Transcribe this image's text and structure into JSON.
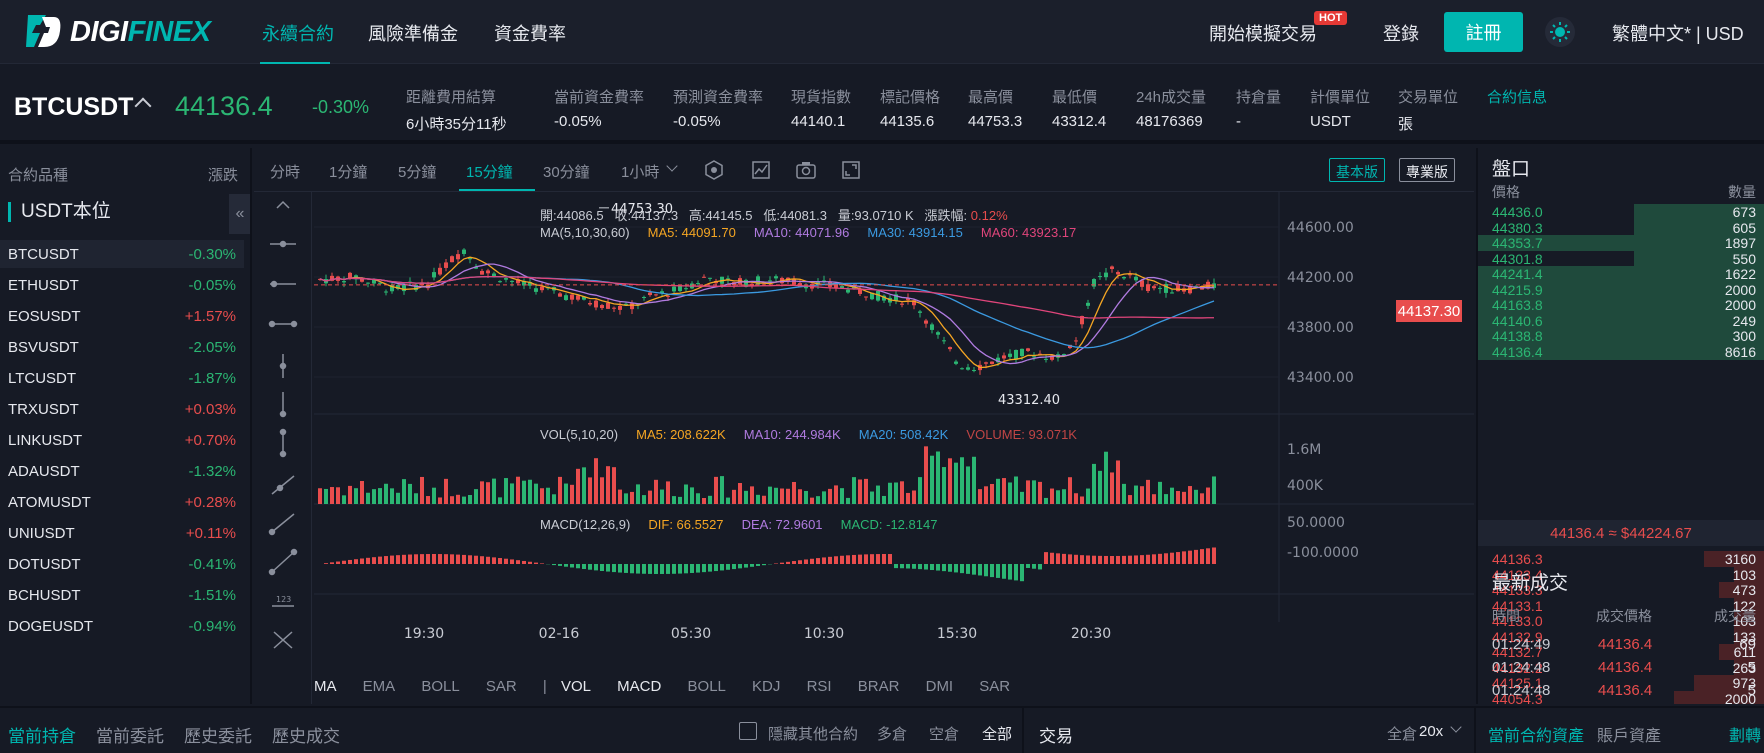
{
  "brand": {
    "logo_text_main": "DIGI",
    "logo_text_accent": "FINEX"
  },
  "nav": {
    "links": [
      "永續合約",
      "風險準備金",
      "資金費率"
    ],
    "demo_trading": "開始模擬交易",
    "hot": "HOT",
    "login": "登錄",
    "register": "註冊",
    "language": "繁體中文* | USD"
  },
  "ticker": {
    "symbol": "BTCUSDT",
    "last_price": "44136.4",
    "change": "-0.30%",
    "stats": [
      {
        "label": "距離費用結算",
        "value": "6小時35分11秒"
      },
      {
        "label": "當前資金費率",
        "value": "-0.05%"
      },
      {
        "label": "預測資金費率",
        "value": "-0.05%"
      },
      {
        "label": "現貨指數",
        "value": "44140.1"
      },
      {
        "label": "標記價格",
        "value": "44135.6"
      },
      {
        "label": "最高價",
        "value": "44753.3"
      },
      {
        "label": "最低價",
        "value": "43312.4"
      },
      {
        "label": "24h成交量",
        "value": "48176369"
      },
      {
        "label": "持倉量",
        "value": "-"
      },
      {
        "label": "計價單位",
        "value": "USDT"
      },
      {
        "label": "交易單位",
        "value": "張"
      }
    ],
    "contract_info": "合約信息"
  },
  "markets": {
    "header_left": "合約品種",
    "header_right": "漲跌",
    "group": "USDT本位",
    "collapse": "«",
    "rows": [
      {
        "name": "BTCUSDT",
        "change": "-0.30%"
      },
      {
        "name": "ETHUSDT",
        "change": "-0.05%"
      },
      {
        "name": "EOSUSDT",
        "change": "+1.57%"
      },
      {
        "name": "BSVUSDT",
        "change": "-2.05%"
      },
      {
        "name": "LTCUSDT",
        "change": "-1.87%"
      },
      {
        "name": "TRXUSDT",
        "change": "+0.03%"
      },
      {
        "name": "LINKUSDT",
        "change": "+0.70%"
      },
      {
        "name": "ADAUSDT",
        "change": "-1.32%"
      },
      {
        "name": "ATOMUSDT",
        "change": "+0.28%"
      },
      {
        "name": "UNIUSDT",
        "change": "+0.11%"
      },
      {
        "name": "DOTUSDT",
        "change": "-0.41%"
      },
      {
        "name": "BCHUSDT",
        "change": "-1.51%"
      },
      {
        "name": "DOGEUSDT",
        "change": "-0.94%"
      }
    ]
  },
  "chart": {
    "timeframes": [
      "分時",
      "1分鐘",
      "5分鐘",
      "15分鐘",
      "30分鐘",
      "1小時"
    ],
    "active_timeframe": "15分鐘",
    "version_basic": "基本版",
    "version_pro": "專業版",
    "ohlc": {
      "open": "開:44086.5",
      "close": "收:44137.3",
      "high": "高:44145.5",
      "low": "低:44081.3",
      "vol": "量:93.0710 K",
      "chg_label": "漲跌幅:",
      "chg_value": "0.12%"
    },
    "ma_legend": {
      "title": "MA(5,10,30,60)",
      "ma5": "MA5: 44091.70",
      "ma10": "MA10: 44071.96",
      "ma30": "MA30: 43914.15",
      "ma60": "MA60: 43923.17"
    },
    "vol_legend": {
      "title": "VOL(5,10,20)",
      "ma5": "MA5: 208.622K",
      "ma10": "MA10: 244.984K",
      "ma20": "MA20: 508.42K",
      "volume": "VOLUME: 93.071K"
    },
    "macd_legend": {
      "title": "MACD(12,26,9)",
      "dif": "DIF: 66.5527",
      "dea": "DEA: 72.9601",
      "macd": "MACD: -12.8147"
    },
    "high_marker": "44753.30",
    "low_marker": "43312.40",
    "current_price_tag": "44137.30",
    "price_axis": [
      "44600.00",
      "44200.00",
      "43800.00",
      "43400.00"
    ],
    "vol_axis": [
      "1.6M",
      "400K"
    ],
    "macd_axis": [
      "50.0000",
      "-100.0000"
    ],
    "time_axis": [
      "19:30",
      "02-16",
      "05:30",
      "10:30",
      "15:30",
      "20:30"
    ],
    "indicators_main": [
      "MA",
      "EMA",
      "BOLL",
      "SAR"
    ],
    "indicators_sub": [
      "VOL",
      "MACD",
      "BOLL",
      "KDJ",
      "RSI",
      "BRAR",
      "DMI",
      "SAR"
    ],
    "colors": {
      "up": "#e84d4d",
      "down": "#2bb673",
      "ma5": "#f5a623",
      "ma10": "#b07be0",
      "ma30": "#3b9ae1",
      "ma60": "#e0457b"
    }
  },
  "chart_data": {
    "type": "candlestick",
    "x": [
      "19:30",
      "02-16",
      "05:30",
      "10:30",
      "15:30",
      "20:30"
    ],
    "ylim": [
      43200,
      44800
    ],
    "high": 44753.3,
    "low": 43312.4,
    "last": 44137.3
  },
  "orderbook": {
    "title": "盤口",
    "col_price": "價格",
    "col_qty": "數量",
    "asks": [
      {
        "p": "44436.0",
        "q": "673"
      },
      {
        "p": "44380.3",
        "q": "605"
      },
      {
        "p": "44353.7",
        "q": "1897"
      },
      {
        "p": "44301.8",
        "q": "550"
      },
      {
        "p": "44241.4",
        "q": "1622"
      },
      {
        "p": "44215.9",
        "q": "2000"
      },
      {
        "p": "44163.8",
        "q": "2000"
      },
      {
        "p": "44140.6",
        "q": "249"
      },
      {
        "p": "44138.8",
        "q": "300"
      },
      {
        "p": "44136.4",
        "q": "8616"
      }
    ],
    "mid": "44136.4 ≈ $44224.67",
    "bids": [
      {
        "p": "44136.3",
        "q": "3160"
      },
      {
        "p": "44133.4",
        "q": "103"
      },
      {
        "p": "44133.3",
        "q": "473"
      },
      {
        "p": "44133.1",
        "q": "122"
      },
      {
        "p": "44133.0",
        "q": "103"
      },
      {
        "p": "44132.9",
        "q": "133"
      },
      {
        "p": "44132.7",
        "q": "611"
      },
      {
        "p": "44132.2",
        "q": "263"
      },
      {
        "p": "44125.1",
        "q": "973"
      },
      {
        "p": "44054.3",
        "q": "2000"
      }
    ]
  },
  "trades": {
    "title": "最新成交",
    "col_time": "時間",
    "col_price": "成交價格",
    "col_qty": "成交量",
    "rows": [
      {
        "t": "01:24:49",
        "p": "44136.4",
        "q": "69"
      },
      {
        "t": "01:24:48",
        "p": "44136.4",
        "q": "5"
      },
      {
        "t": "01:24:48",
        "p": "44136.4",
        "q": "5"
      }
    ]
  },
  "bottom": {
    "tabs": [
      "當前持倉",
      "當前委託",
      "歷史委託",
      "歷史成交"
    ],
    "hide_other": "隱藏其他合約",
    "filters": [
      "多倉",
      "空倉",
      "全部"
    ],
    "trade_title": "交易",
    "margin_mode": "全倉",
    "leverage": "20x",
    "asset_tabs": [
      "當前合約資產",
      "賬戶資產"
    ],
    "transfer": "劃轉"
  }
}
